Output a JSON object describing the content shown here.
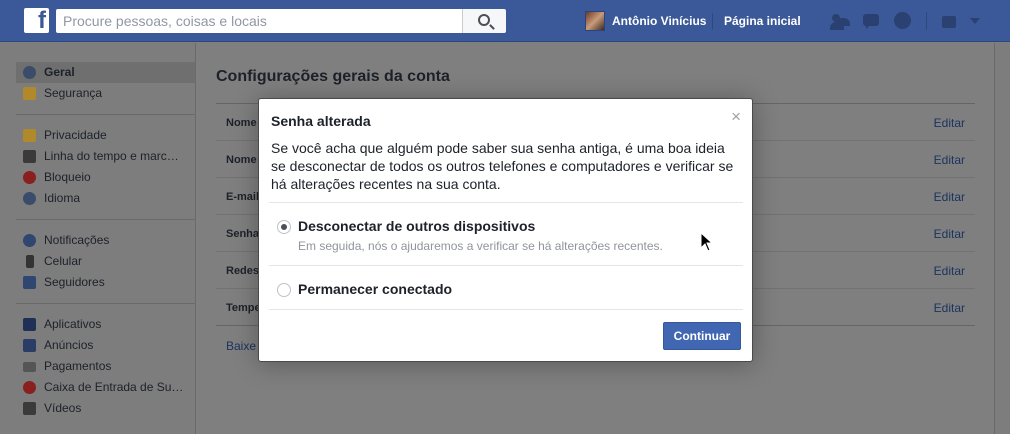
{
  "topbar": {
    "logo": "f",
    "search_placeholder": "Procure pessoas, coisas e locais",
    "user_name": "Antônio Vinícius",
    "home_link": "Página inicial"
  },
  "sidebar": {
    "groups": [
      [
        {
          "label": "Geral",
          "icon": "gear-icon",
          "active": true
        },
        {
          "label": "Segurança",
          "icon": "shield-icon",
          "active": false
        }
      ],
      [
        {
          "label": "Privacidade",
          "icon": "lock-icon",
          "active": false
        },
        {
          "label": "Linha do tempo e marc…",
          "icon": "timeline-icon",
          "active": false
        },
        {
          "label": "Bloqueio",
          "icon": "block-icon",
          "active": false
        },
        {
          "label": "Idioma",
          "icon": "globe-icon",
          "active": false
        }
      ],
      [
        {
          "label": "Notificações",
          "icon": "notifications-icon",
          "active": false
        },
        {
          "label": "Celular",
          "icon": "mobile-icon",
          "active": false
        },
        {
          "label": "Seguidores",
          "icon": "rss-icon",
          "active": false
        }
      ],
      [
        {
          "label": "Aplicativos",
          "icon": "apps-icon",
          "active": false
        },
        {
          "label": "Anúncios",
          "icon": "ads-icon",
          "active": false
        },
        {
          "label": "Pagamentos",
          "icon": "card-icon",
          "active": false
        },
        {
          "label": "Caixa de Entrada de Su…",
          "icon": "support-icon",
          "active": false
        },
        {
          "label": "Vídeos",
          "icon": "film-icon",
          "active": false
        }
      ]
    ]
  },
  "main": {
    "title": "Configurações gerais da conta",
    "rows": [
      {
        "label": "Nome",
        "edit": "Editar"
      },
      {
        "label": "Nome",
        "edit": "Editar"
      },
      {
        "label": "E-mail",
        "edit": "Editar"
      },
      {
        "label": "Senha",
        "edit": "Editar"
      },
      {
        "label": "Redes",
        "edit": "Editar"
      },
      {
        "label": "Tempe",
        "edit": "Editar"
      }
    ],
    "download_link": "Baixe"
  },
  "modal": {
    "title": "Senha alterada",
    "close": "×",
    "body": "Se você acha que alguém pode saber sua senha antiga, é uma boa ideia se desconectar de todos os outros telefones e computadores e verificar se há alterações recentes na sua conta.",
    "option1_label": "Desconectar de outros dispositivos",
    "option1_sub": "Em seguida, nós o ajudaremos a verificar se há alterações recentes.",
    "option2_label": "Permanecer conectado",
    "selected_option": 1,
    "continue_label": "Continuar"
  },
  "colors": {
    "brand": "#3b5998",
    "button": "#4267b2",
    "link": "#365899"
  }
}
